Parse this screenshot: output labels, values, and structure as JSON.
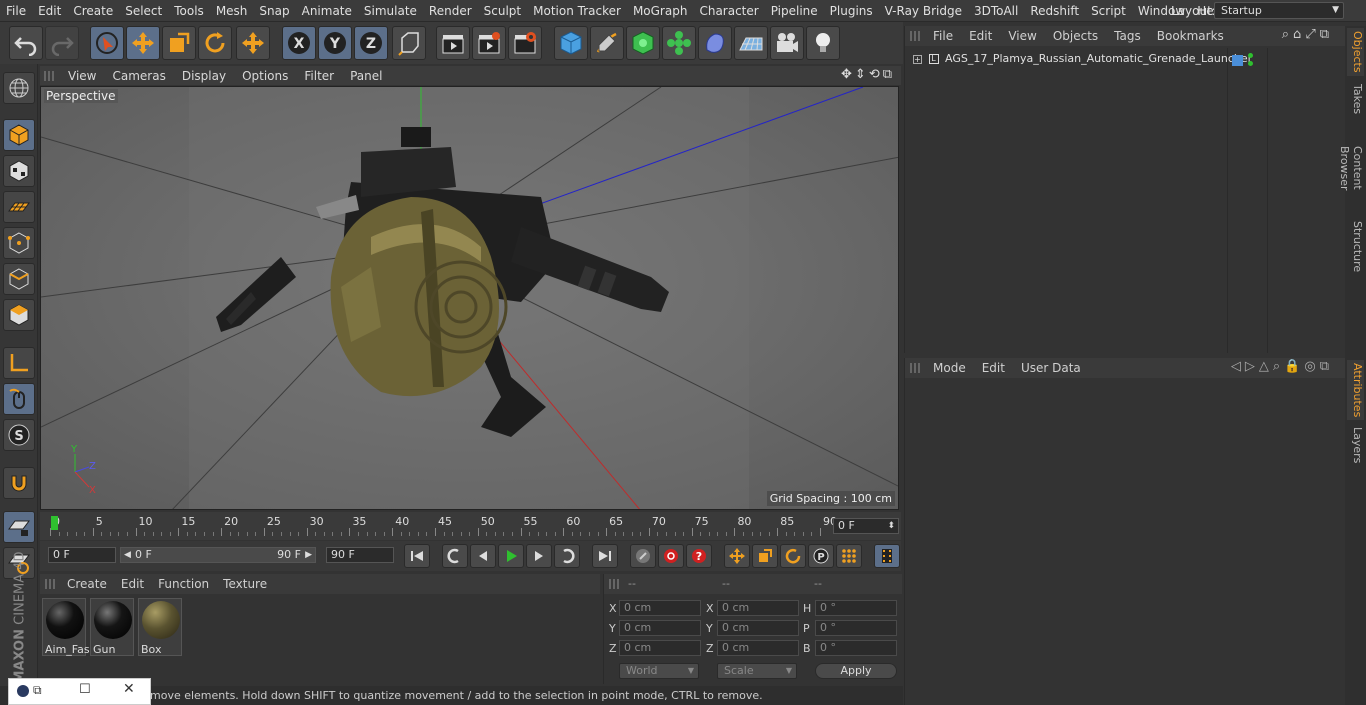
{
  "menubar": {
    "items": [
      "File",
      "Edit",
      "Create",
      "Select",
      "Tools",
      "Mesh",
      "Snap",
      "Animate",
      "Simulate",
      "Render",
      "Sculpt",
      "Motion Tracker",
      "MoGraph",
      "Character",
      "Pipeline",
      "Plugins",
      "V-Ray Bridge",
      "3DToAll",
      "Redshift",
      "Script",
      "Window",
      "Help"
    ],
    "layout_label": "Layout:",
    "layout_value": "Startup"
  },
  "viewport": {
    "menu": [
      "View",
      "Cameras",
      "Display",
      "Options",
      "Filter",
      "Panel"
    ],
    "label": "Perspective",
    "grid_spacing": "Grid Spacing : 100 cm"
  },
  "timeline": {
    "ticks": [
      "0",
      "5",
      "10",
      "15",
      "20",
      "25",
      "30",
      "35",
      "40",
      "45",
      "50",
      "55",
      "60",
      "65",
      "70",
      "75",
      "80",
      "85",
      "90"
    ],
    "current_frame": "0 F"
  },
  "playback": {
    "start_frame": "0 F",
    "range_start": "0 F",
    "range_end": "90 F",
    "end_frame": "90 F"
  },
  "material_manager": {
    "menu": [
      "Create",
      "Edit",
      "Function",
      "Texture"
    ],
    "materials": [
      {
        "name": "Aim_Fas",
        "color": "#111111"
      },
      {
        "name": "Gun",
        "color": "#151515"
      },
      {
        "name": "Box",
        "color": "#5a5330"
      }
    ]
  },
  "coordinates": {
    "header": [
      "--",
      "--",
      "--"
    ],
    "rows": [
      {
        "a_label": "X",
        "a_val": "0 cm",
        "b_label": "X",
        "b_val": "0 cm",
        "c_label": "H",
        "c_val": "0 °"
      },
      {
        "a_label": "Y",
        "a_val": "0 cm",
        "b_label": "Y",
        "b_val": "0 cm",
        "c_label": "P",
        "c_val": "0 °"
      },
      {
        "a_label": "Z",
        "a_val": "0 cm",
        "b_label": "Z",
        "b_val": "0 cm",
        "c_label": "B",
        "c_val": "0 °"
      }
    ],
    "space": "World",
    "mode": "Scale",
    "apply": "Apply"
  },
  "objects_panel": {
    "menu": [
      "File",
      "Edit",
      "View",
      "Objects",
      "Tags",
      "Bookmarks"
    ],
    "object_name": "AGS_17_Plamya_Russian_Automatic_Grenade_Launcher"
  },
  "attributes_panel": {
    "menu": [
      "Mode",
      "Edit",
      "User Data"
    ]
  },
  "side_tabs": [
    "Objects",
    "Takes",
    "Content Browser",
    "Structure",
    "Attributes",
    "Layers"
  ],
  "status": {
    "text": "move elements. Hold down SHIFT to quantize movement / add to the selection in point mode, CTRL to remove."
  },
  "brand": {
    "maxon": "MAXON",
    "product": "CINEMA 4D"
  }
}
